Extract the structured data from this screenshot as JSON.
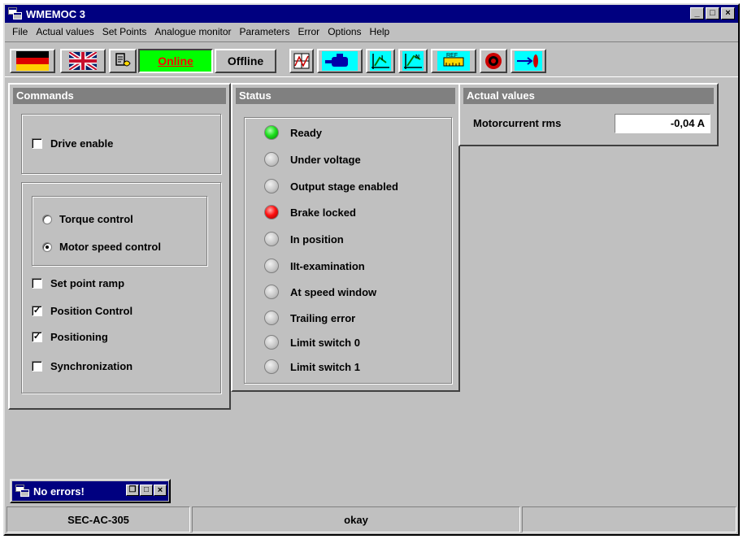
{
  "window": {
    "title": "WMEMOC 3",
    "controls": [
      "_",
      "□",
      "×"
    ]
  },
  "menu": [
    "File",
    "Actual values",
    "Set Points",
    "Analogue monitor",
    "Parameters",
    "Error",
    "Options",
    "Help"
  ],
  "toolbar": {
    "icons": [
      "german-flag-icon",
      "uk-flag-icon",
      "drive-config-icon",
      "scope-icon",
      "motor-icon",
      "torque-chart-icon",
      "speed-chart-icon",
      "reference-icon",
      "target-icon",
      "position-arrow-icon"
    ],
    "online_label": "Online",
    "offline_label": "Offline"
  },
  "commands": {
    "title": "Commands",
    "drive_enable": {
      "label": "Drive enable",
      "checked": false
    },
    "control_mode": [
      {
        "label": "Torque control",
        "selected": false
      },
      {
        "label": "Motor speed control",
        "selected": true
      }
    ],
    "options": [
      {
        "label": "Set point ramp",
        "checked": false
      },
      {
        "label": "Position Control",
        "checked": true
      },
      {
        "label": "Positioning",
        "checked": true
      },
      {
        "label": "Synchronization",
        "checked": false
      }
    ]
  },
  "status": {
    "title": "Status",
    "items": [
      {
        "label": "Ready",
        "state": "green"
      },
      {
        "label": "Under voltage",
        "state": "off"
      },
      {
        "label": "Output stage enabled",
        "state": "off"
      },
      {
        "label": "Brake locked",
        "state": "red"
      },
      {
        "label": "In position",
        "state": "off"
      },
      {
        "label": "IIt-examination",
        "state": "off"
      },
      {
        "label": "At speed window",
        "state": "off"
      },
      {
        "label": "Trailing error",
        "state": "off"
      },
      {
        "label": "Limit switch 0",
        "state": "off"
      },
      {
        "label": "Limit switch 1",
        "state": "off"
      }
    ]
  },
  "actual_values": {
    "title": "Actual values",
    "motorcurrent_label": "Motorcurrent rms",
    "motorcurrent_value": "-0,04 A"
  },
  "error_window": {
    "title": "No errors!"
  },
  "statusbar": {
    "device": "SEC-AC-305",
    "message": "okay",
    "extra": ""
  },
  "colors": {
    "titlebar": "#000080",
    "online": "#00ff00",
    "online_text": "#ff0000",
    "face": "#c0c0c0"
  }
}
